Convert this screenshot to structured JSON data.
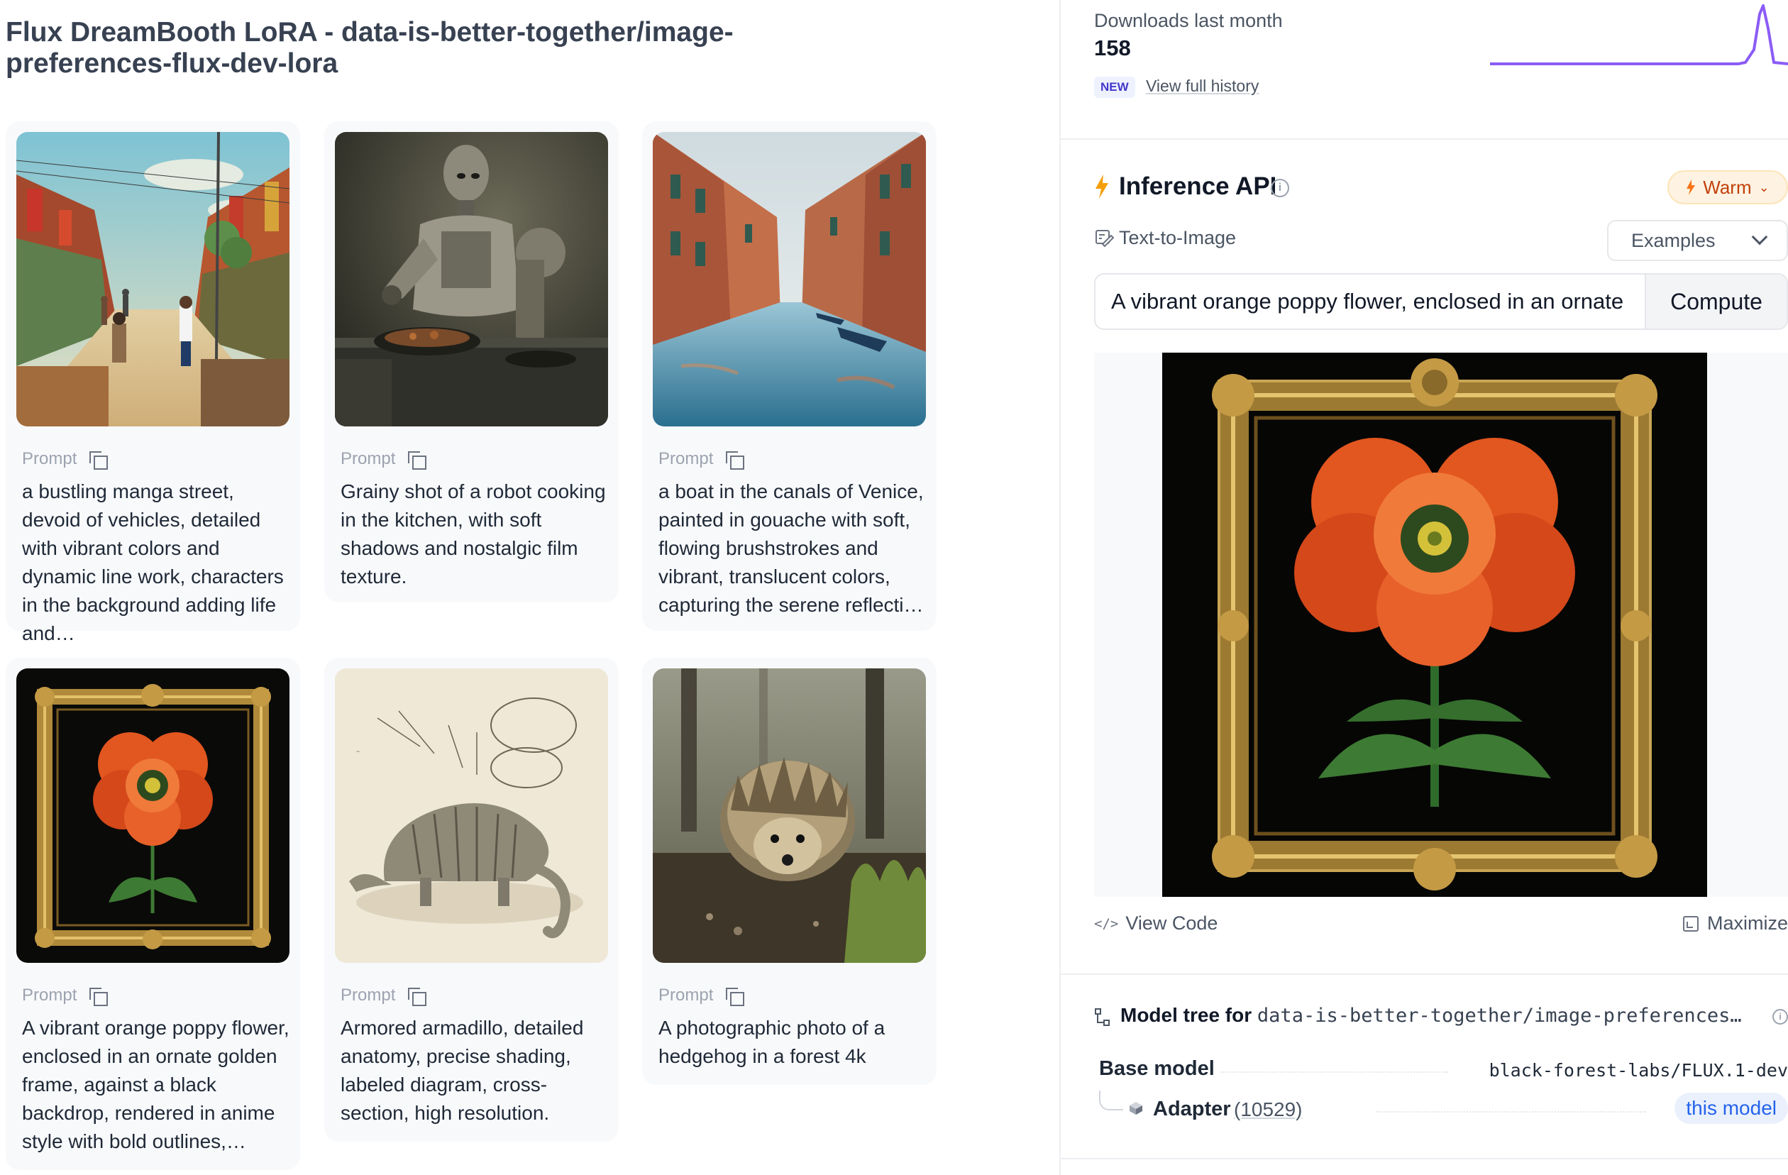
{
  "page": {
    "title": "Flux DreamBooth LoRA - data-is-better-together/image-preferences-flux-dev-lora"
  },
  "gallery": {
    "prompt_label": "Prompt",
    "cards": [
      {
        "prompt": "a bustling manga street, devoid of vehicles, detailed with vibrant colors and dynamic line work, characters in the background adding life and…"
      },
      {
        "prompt": "Grainy shot of a robot cooking in the kitchen, with soft shadows and nostalgic film texture."
      },
      {
        "prompt": "a boat in the canals of Venice, painted in gouache with soft, flowing brushstrokes and vibrant, translucent colors, capturing the serene reflecti…"
      },
      {
        "prompt": "A vibrant orange poppy flower, enclosed in an ornate golden frame, against a black backdrop, rendered in anime style with bold outlines,…"
      },
      {
        "prompt": "Armored armadillo, detailed anatomy, precise shading, labeled diagram, cross-section, high resolution."
      },
      {
        "prompt": "A photographic photo of a hedgehog in a forest 4k"
      }
    ]
  },
  "downloads": {
    "label": "Downloads last month",
    "count": "158",
    "badge": "NEW",
    "history_link": "View full history",
    "sparkline_color": "#8b5cf6"
  },
  "inference": {
    "title": "Inference API",
    "status": "Warm",
    "status_color": "#f97316",
    "task": "Text-to-Image",
    "examples_label": "Examples",
    "input_value": "A vibrant orange poppy flower, enclosed in an ornate golden frame, against a black backdrop",
    "compute_label": "Compute",
    "view_code_label": "View Code",
    "maximize_label": "Maximize"
  },
  "model_tree": {
    "title_prefix": "Model tree for",
    "repo": "data-is-better-together/image-preferences…",
    "base_label": "Base model",
    "base_value": "black-forest-labs/FLUX.1-dev",
    "adapter_label": "Adapter",
    "adapter_count": "(10529)",
    "this_model_label": "this model"
  },
  "icons": {
    "copy": "copy-icon",
    "info": "info-icon",
    "bolt": "lightning-bolt-icon",
    "text_to_image": "text-to-image-icon",
    "chevron": "chevron-down-icon",
    "code": "code-icon",
    "maximize": "maximize-icon",
    "tree": "model-tree-icon",
    "cube": "cube-icon"
  }
}
